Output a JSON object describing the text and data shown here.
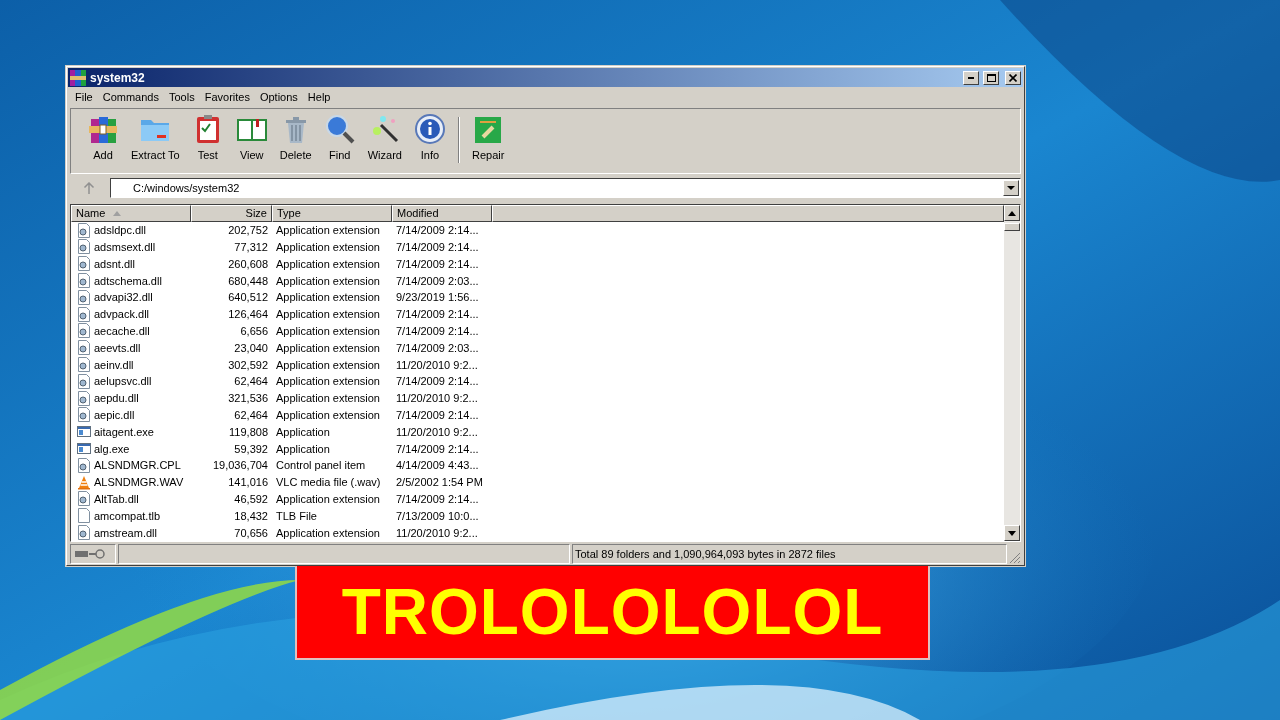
{
  "window": {
    "title": "system32",
    "controls": [
      {
        "kind": "minimize"
      },
      {
        "kind": "maximize"
      },
      {
        "kind": "close"
      }
    ]
  },
  "menu": [
    "File",
    "Commands",
    "Tools",
    "Favorites",
    "Options",
    "Help"
  ],
  "toolbar": [
    {
      "kind": "add",
      "label": "Add"
    },
    {
      "kind": "extract",
      "label": "Extract To"
    },
    {
      "kind": "test",
      "label": "Test"
    },
    {
      "kind": "view",
      "label": "View"
    },
    {
      "kind": "delete",
      "label": "Delete"
    },
    {
      "kind": "find",
      "label": "Find"
    },
    {
      "kind": "wizard",
      "label": "Wizard"
    },
    {
      "kind": "info",
      "label": "Info"
    },
    {
      "kind": "separator"
    },
    {
      "kind": "repair",
      "label": "Repair"
    }
  ],
  "address": {
    "value": "C:/windows/system32"
  },
  "table": {
    "columns": [
      {
        "label": "Name",
        "sorted": true
      },
      {
        "label": "Size",
        "sorted": false
      },
      {
        "label": "Type",
        "sorted": false
      },
      {
        "label": "Modified",
        "sorted": false
      }
    ],
    "rows": [
      {
        "kind": "extension",
        "cells": [
          "adsldpc.dll",
          "202,752",
          "Application extension",
          "7/14/2009 2:14..."
        ]
      },
      {
        "kind": "extension",
        "cells": [
          "adsmsext.dll",
          "77,312",
          "Application extension",
          "7/14/2009 2:14..."
        ]
      },
      {
        "kind": "extension",
        "cells": [
          "adsnt.dll",
          "260,608",
          "Application extension",
          "7/14/2009 2:14..."
        ]
      },
      {
        "kind": "extension",
        "cells": [
          "adtschema.dll",
          "680,448",
          "Application extension",
          "7/14/2009 2:03..."
        ]
      },
      {
        "kind": "extension",
        "cells": [
          "advapi32.dll",
          "640,512",
          "Application extension",
          "9/23/2019 1:56..."
        ]
      },
      {
        "kind": "extension",
        "cells": [
          "advpack.dll",
          "126,464",
          "Application extension",
          "7/14/2009 2:14..."
        ]
      },
      {
        "kind": "extension",
        "cells": [
          "aecache.dll",
          "6,656",
          "Application extension",
          "7/14/2009 2:14..."
        ]
      },
      {
        "kind": "extension",
        "cells": [
          "aeevts.dll",
          "23,040",
          "Application extension",
          "7/14/2009 2:03..."
        ]
      },
      {
        "kind": "extension",
        "cells": [
          "aeinv.dll",
          "302,592",
          "Application extension",
          "11/20/2010 9:2..."
        ]
      },
      {
        "kind": "extension",
        "cells": [
          "aelupsvc.dll",
          "62,464",
          "Application extension",
          "7/14/2009 2:14..."
        ]
      },
      {
        "kind": "extension",
        "cells": [
          "aepdu.dll",
          "321,536",
          "Application extension",
          "11/20/2010 9:2..."
        ]
      },
      {
        "kind": "extension",
        "cells": [
          "aepic.dll",
          "62,464",
          "Application extension",
          "7/14/2009 2:14..."
        ]
      },
      {
        "kind": "application",
        "cells": [
          "aitagent.exe",
          "119,808",
          "Application",
          "11/20/2010 9:2..."
        ]
      },
      {
        "kind": "application",
        "cells": [
          "alg.exe",
          "59,392",
          "Application",
          "7/14/2009 2:14..."
        ]
      },
      {
        "kind": "extension",
        "cells": [
          "ALSNDMGR.CPL",
          "19,036,704",
          "Control panel item",
          "4/14/2009 4:43..."
        ]
      },
      {
        "kind": "media",
        "cells": [
          "ALSNDMGR.WAV",
          "141,016",
          "VLC media file (.wav)",
          "2/5/2002 1:54 PM"
        ]
      },
      {
        "kind": "extension",
        "cells": [
          "AltTab.dll",
          "46,592",
          "Application extension",
          "7/14/2009 2:14..."
        ]
      },
      {
        "kind": "file",
        "cells": [
          "amcompat.tlb",
          "18,432",
          "TLB File",
          "7/13/2009 10:0..."
        ]
      },
      {
        "kind": "extension",
        "cells": [
          "amstream.dll",
          "70,656",
          "Application extension",
          "11/20/2010 9:2..."
        ]
      }
    ]
  },
  "status_bar": {
    "text": "Total 89 folders and 1,090,964,093 bytes in 2872 files"
  },
  "banner": {
    "text": "TROLOLOLOLOL"
  }
}
